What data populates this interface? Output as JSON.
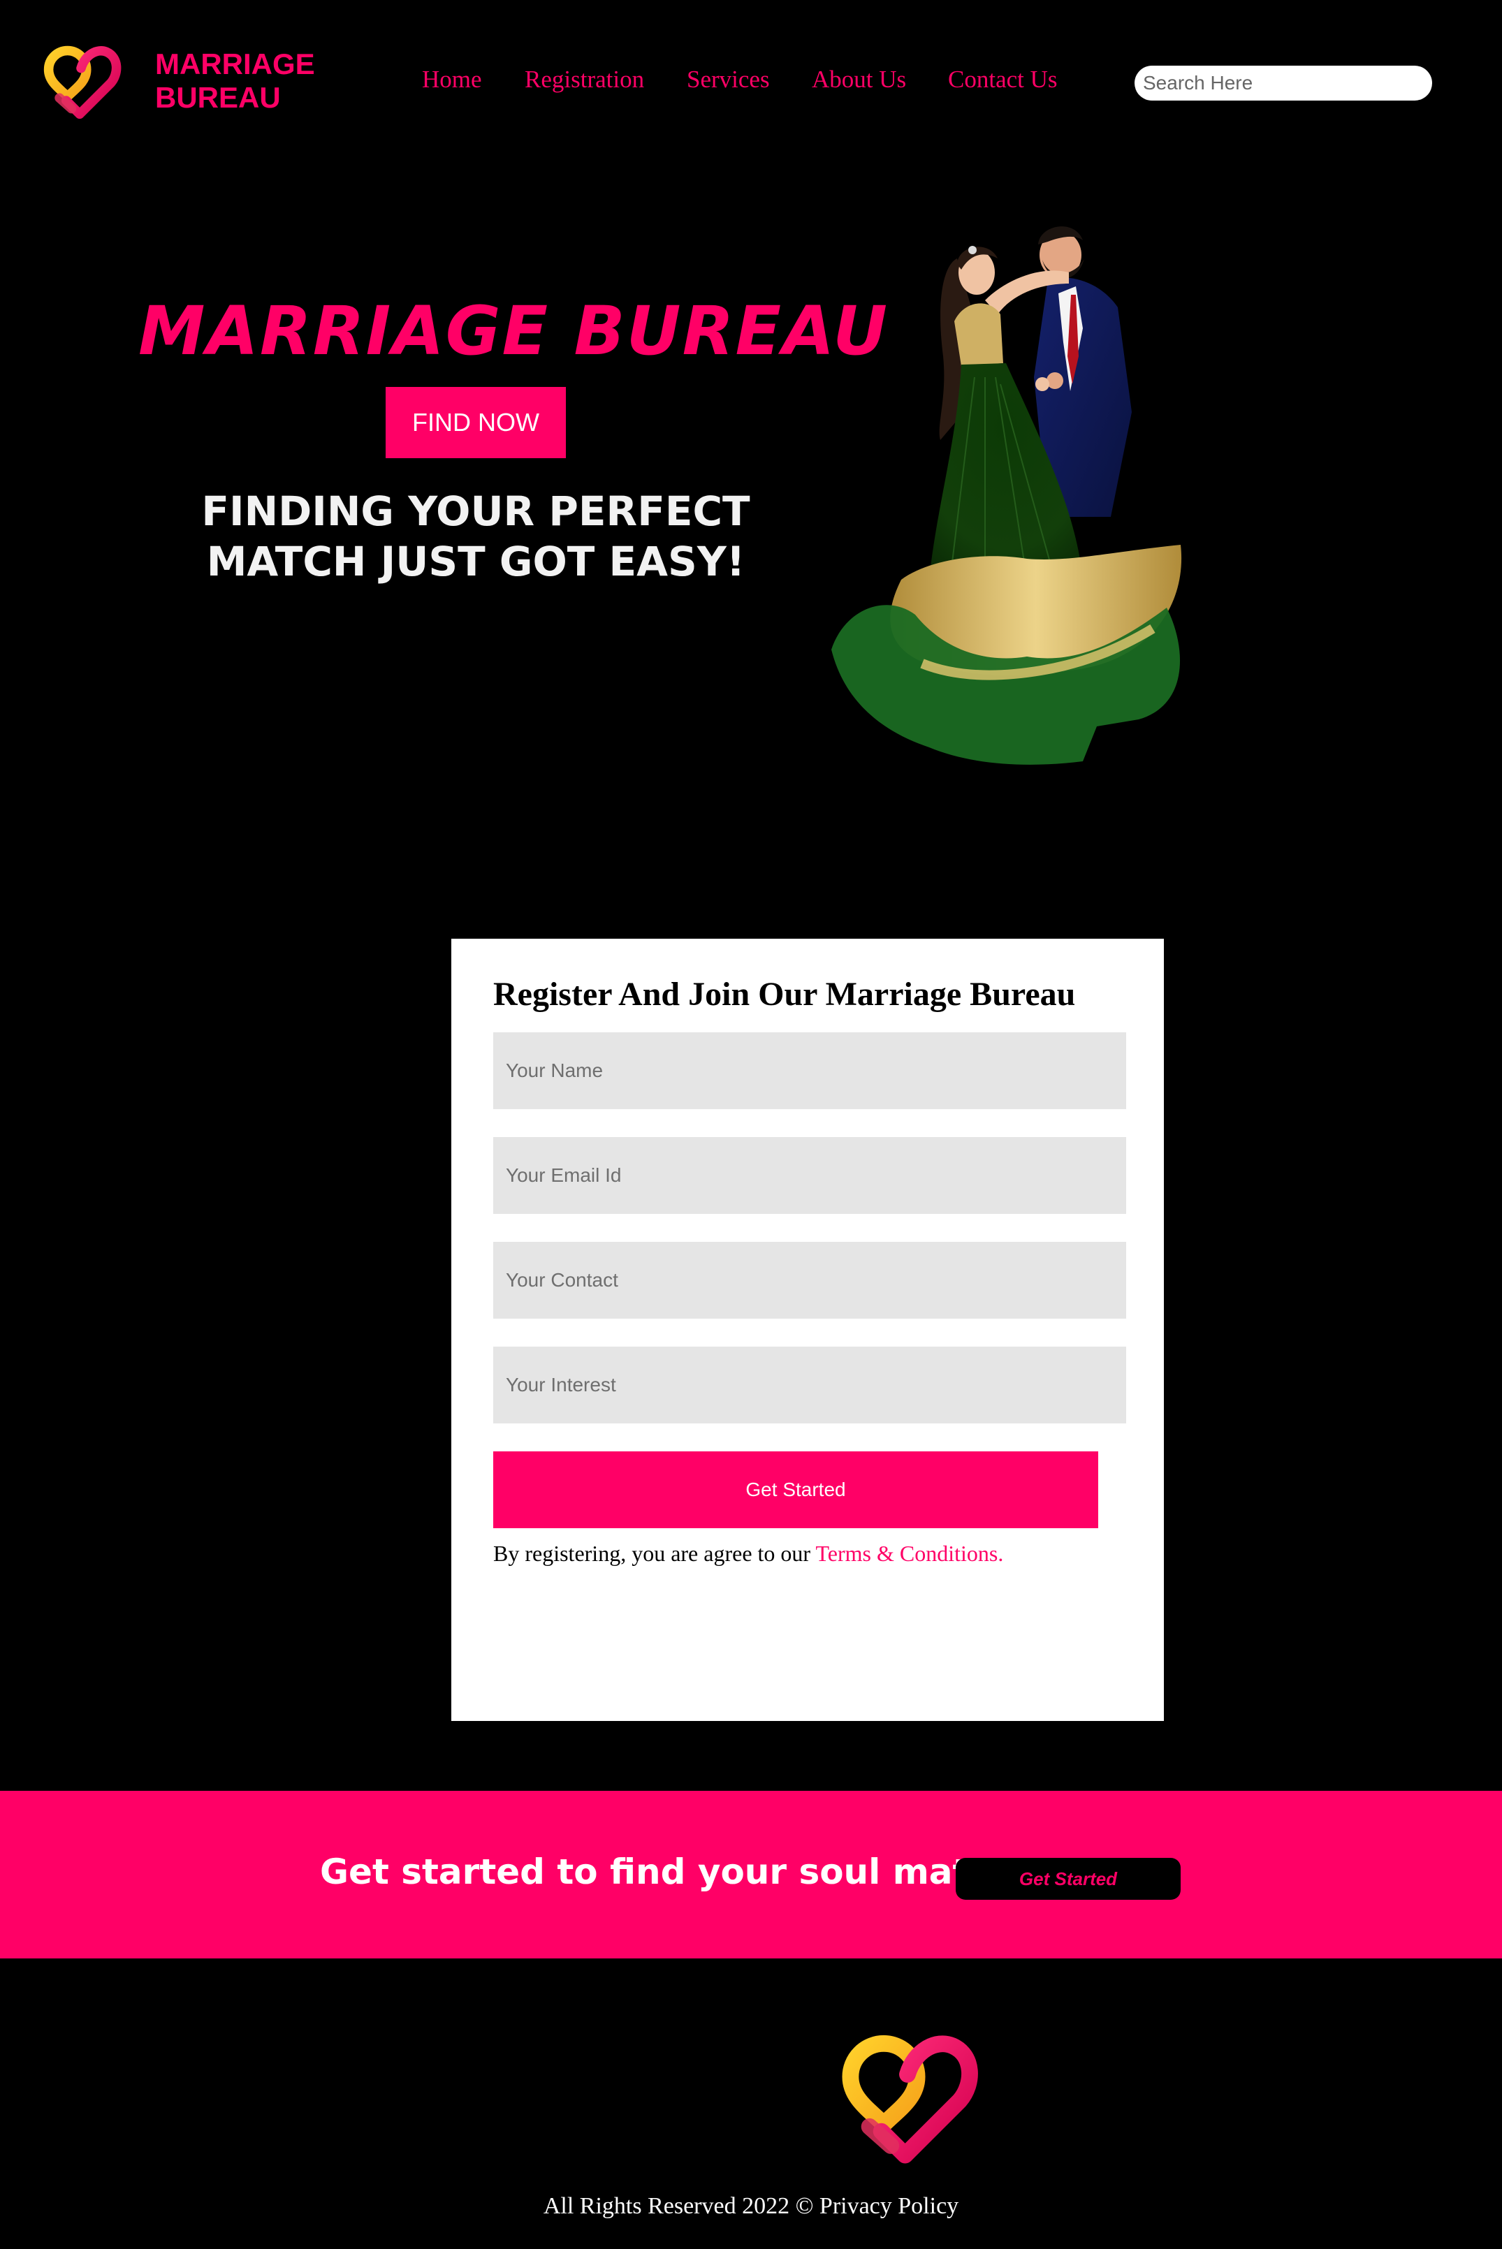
{
  "brand": {
    "line1": "MARRIAGE",
    "line2": "BUREAU",
    "accent_color": "#ff0066"
  },
  "nav": {
    "items": [
      {
        "label": "Home"
      },
      {
        "label": "Registration"
      },
      {
        "label": "Services"
      },
      {
        "label": "About Us"
      },
      {
        "label": "Contact Us"
      }
    ],
    "search_placeholder": "Search Here"
  },
  "hero": {
    "title": "MARRIAGE BUREAU",
    "button_label": "FIND NOW",
    "tagline_line1": "FINDING YOUR PERFECT",
    "tagline_line2": "MATCH JUST GOT EASY!",
    "image_icon": "couple-illustration"
  },
  "form": {
    "title": "Register And Join Our Marriage Bureau",
    "fields": [
      {
        "placeholder": "Your Name",
        "value": ""
      },
      {
        "placeholder": "Your Email Id",
        "value": ""
      },
      {
        "placeholder": "Your Contact",
        "value": ""
      },
      {
        "placeholder": "Your Interest",
        "value": ""
      }
    ],
    "submit_label": "Get Started",
    "terms_prefix": "By registering, you are agree to our ",
    "terms_link": "Terms & Conditions."
  },
  "banner": {
    "text": "Get started to find your soul mate!",
    "button_label": "Get Started",
    "background_color": "#ff0066"
  },
  "footer": {
    "text": "All Rights Reserved 2022 © Privacy Policy",
    "logo_icon": "heart-logo-icon"
  }
}
